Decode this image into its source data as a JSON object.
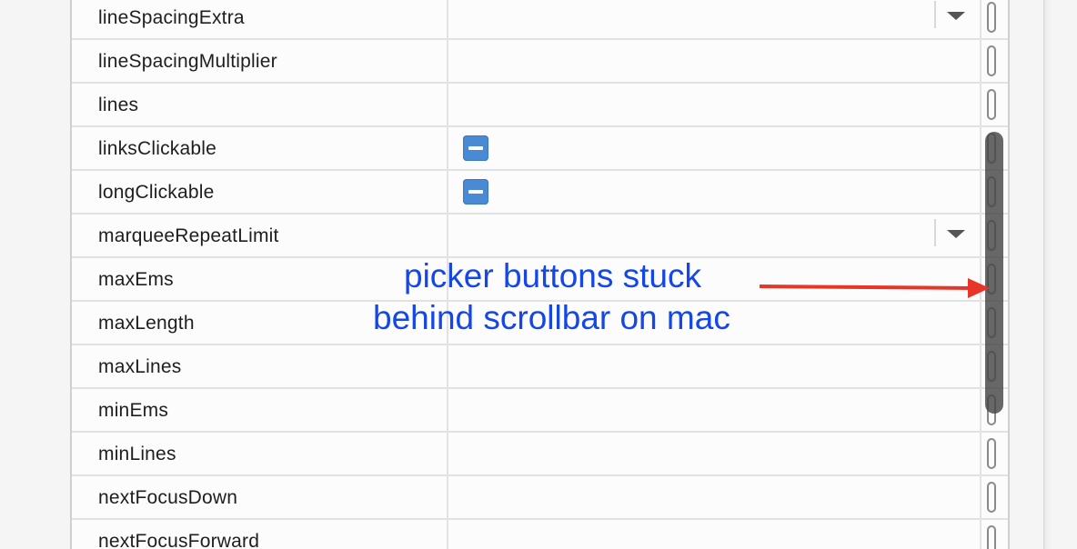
{
  "properties": [
    {
      "name": "lineSpacingExtra",
      "control": "dropdown"
    },
    {
      "name": "lineSpacingMultiplier",
      "control": "none"
    },
    {
      "name": "lines",
      "control": "none"
    },
    {
      "name": "linksClickable",
      "control": "checkbox",
      "state": "indeterminate"
    },
    {
      "name": "longClickable",
      "control": "checkbox",
      "state": "indeterminate"
    },
    {
      "name": "marqueeRepeatLimit",
      "control": "dropdown"
    },
    {
      "name": "maxEms",
      "control": "none"
    },
    {
      "name": "maxLength",
      "control": "none"
    },
    {
      "name": "maxLines",
      "control": "none"
    },
    {
      "name": "minEms",
      "control": "none"
    },
    {
      "name": "minLines",
      "control": "none"
    },
    {
      "name": "nextFocusDown",
      "control": "none"
    },
    {
      "name": "nextFocusForward",
      "control": "none"
    }
  ],
  "annotation": {
    "line1": "picker buttons stuck",
    "line2": "behind scrollbar on mac",
    "color": "#1447e6",
    "arrow_color": "#e8352a"
  },
  "colors": {
    "checkbox": "#4a8ad5",
    "scrollbar": "#464646"
  },
  "icons": {
    "checkbox": "minus-checkbox-icon",
    "dropdown": "dropdown-triangle-icon",
    "picker": "picker-pill-icon"
  }
}
